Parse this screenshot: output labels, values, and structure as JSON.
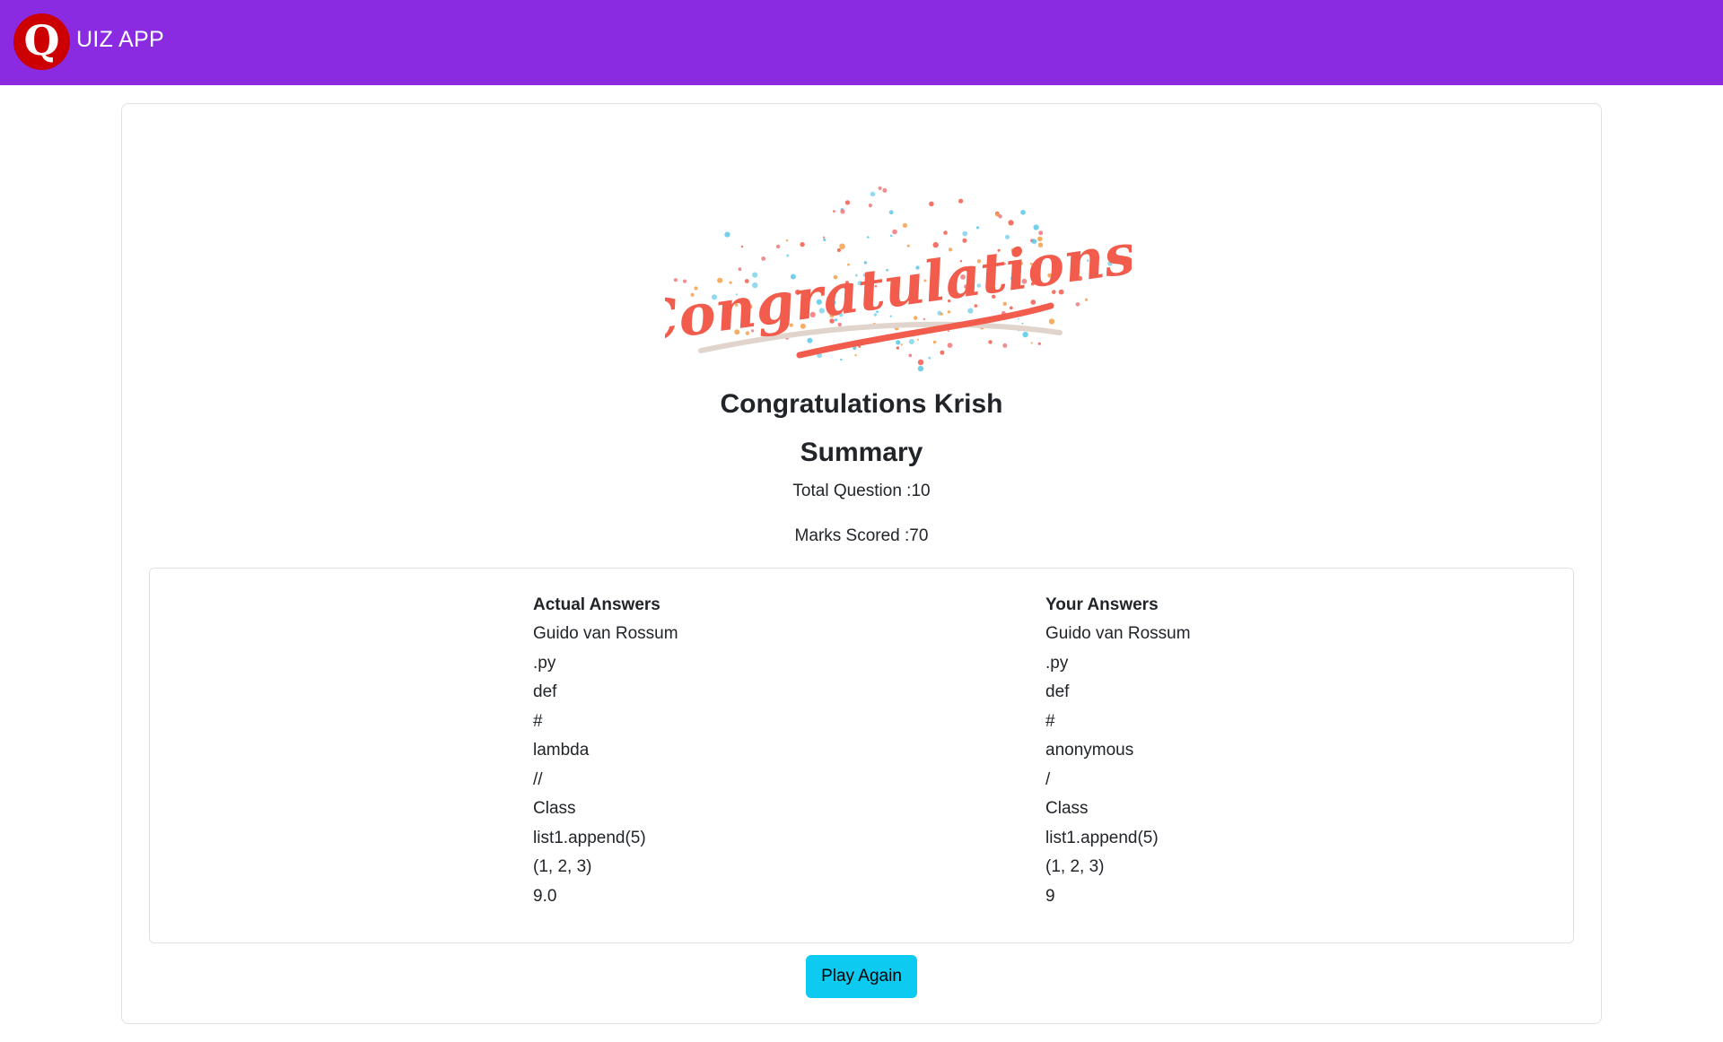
{
  "navbar": {
    "logo_letter": "Q",
    "brand": "UIZ APP",
    "bg_color": "#8a2be2",
    "logo_color": "#cc0000"
  },
  "hero": {
    "image_text": "Congratulations!"
  },
  "result": {
    "greeting": "Congratulations Krish",
    "summary_title": "Summary",
    "total_questions": "Total Question :10",
    "marks_scored": "Marks Scored :70"
  },
  "answers": {
    "actual_header": "Actual Answers",
    "your_header": "Your Answers",
    "actual": [
      "Guido van Rossum",
      ".py",
      "def",
      "#",
      "lambda",
      "//",
      "Class",
      "list1.append(5)",
      "(1, 2, 3)",
      "9.0"
    ],
    "yours": [
      "Guido van Rossum",
      ".py",
      "def",
      "#",
      "anonymous",
      "/",
      "Class",
      "list1.append(5)",
      "(1, 2, 3)",
      "9"
    ]
  },
  "actions": {
    "play_again": "Play Again",
    "button_color": "#0dcaf0"
  }
}
